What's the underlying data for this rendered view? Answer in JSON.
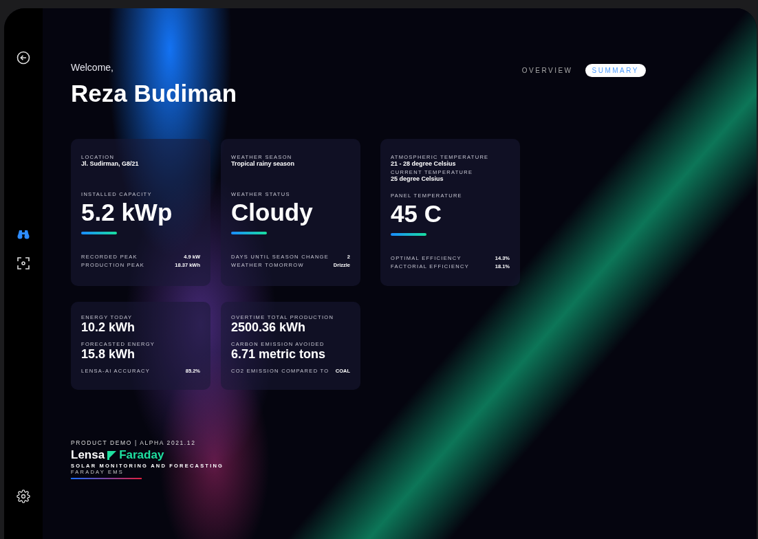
{
  "sidebar": {
    "nav": [
      {
        "kind": "binoculars",
        "selected": true
      },
      {
        "kind": "scan",
        "selected": false
      }
    ]
  },
  "greeting": "Welcome,",
  "user_name": "Reza Budiman",
  "tabs": [
    {
      "label": "OVERVIEW",
      "selected": false
    },
    {
      "label": "SUMMARY",
      "selected": true
    }
  ],
  "cards": [
    {
      "kind": "hero",
      "top": [
        {
          "label": "LOCATION",
          "value": "Jl. Sudirman, G8/21"
        }
      ],
      "metric": {
        "label": "INSTALLED CAPACITY",
        "value": "5.2 kWp"
      },
      "stats": [
        {
          "label": "RECORDED PEAK",
          "value": "4.9 kW"
        },
        {
          "label": "PRODUCTION PEAK",
          "value": "18.37 kWh"
        }
      ]
    },
    {
      "kind": "hero",
      "top": [
        {
          "label": "WEATHER SEASON",
          "value": "Tropical rainy season"
        }
      ],
      "metric": {
        "label": "WEATHER STATUS",
        "value": "Cloudy"
      },
      "stats": [
        {
          "label": "DAYS UNTIL SEASON CHANGE",
          "value": "2"
        },
        {
          "label": "WEATHER TOMORROW",
          "value": "Drizzle"
        }
      ]
    },
    {
      "kind": "hero",
      "top": [
        {
          "label": "ATMOSPHERIC TEMPERATURE",
          "value": "21 - 28 degree Celsius"
        },
        {
          "label": "CURRENT TEMPERATURE",
          "value": "25 degree Celsius"
        }
      ],
      "metric": {
        "label": "PANEL TEMPERATURE",
        "value": "45 C"
      },
      "stats": [
        {
          "label": "OPTIMAL EFFICIENCY",
          "value": "14.3%"
        },
        {
          "label": "FACTORIAL EFFICIENCY",
          "value": "18.1%"
        }
      ]
    },
    {
      "kind": "summary",
      "metrics": [
        {
          "label": "ENERGY TODAY",
          "value": "10.2 kWh"
        },
        {
          "label": "FORECASTED ENERGY",
          "value": "15.8 kWh"
        }
      ],
      "stats": [
        {
          "label": "LENSA-AI ACCURACY",
          "value": "85.2%"
        }
      ]
    },
    {
      "kind": "summary",
      "metrics": [
        {
          "label": "OVERTIME TOTAL PRODUCTION",
          "value": "2500.36 kWh"
        },
        {
          "label": "CARBON EMISSION AVOIDED",
          "value": "6.71 metric tons"
        }
      ],
      "stats": [
        {
          "label": "CO2 EMISSION COMPARED TO",
          "value": "COAL"
        }
      ]
    }
  ],
  "footer": {
    "caption": "PRODUCT DEMO | ALPHA 2021.12",
    "brand_first": "Lensa",
    "brand_second": "Faraday",
    "tagline": "SOLAR MONITORING AND FORECASTING",
    "product": "FARADAY EMS"
  }
}
